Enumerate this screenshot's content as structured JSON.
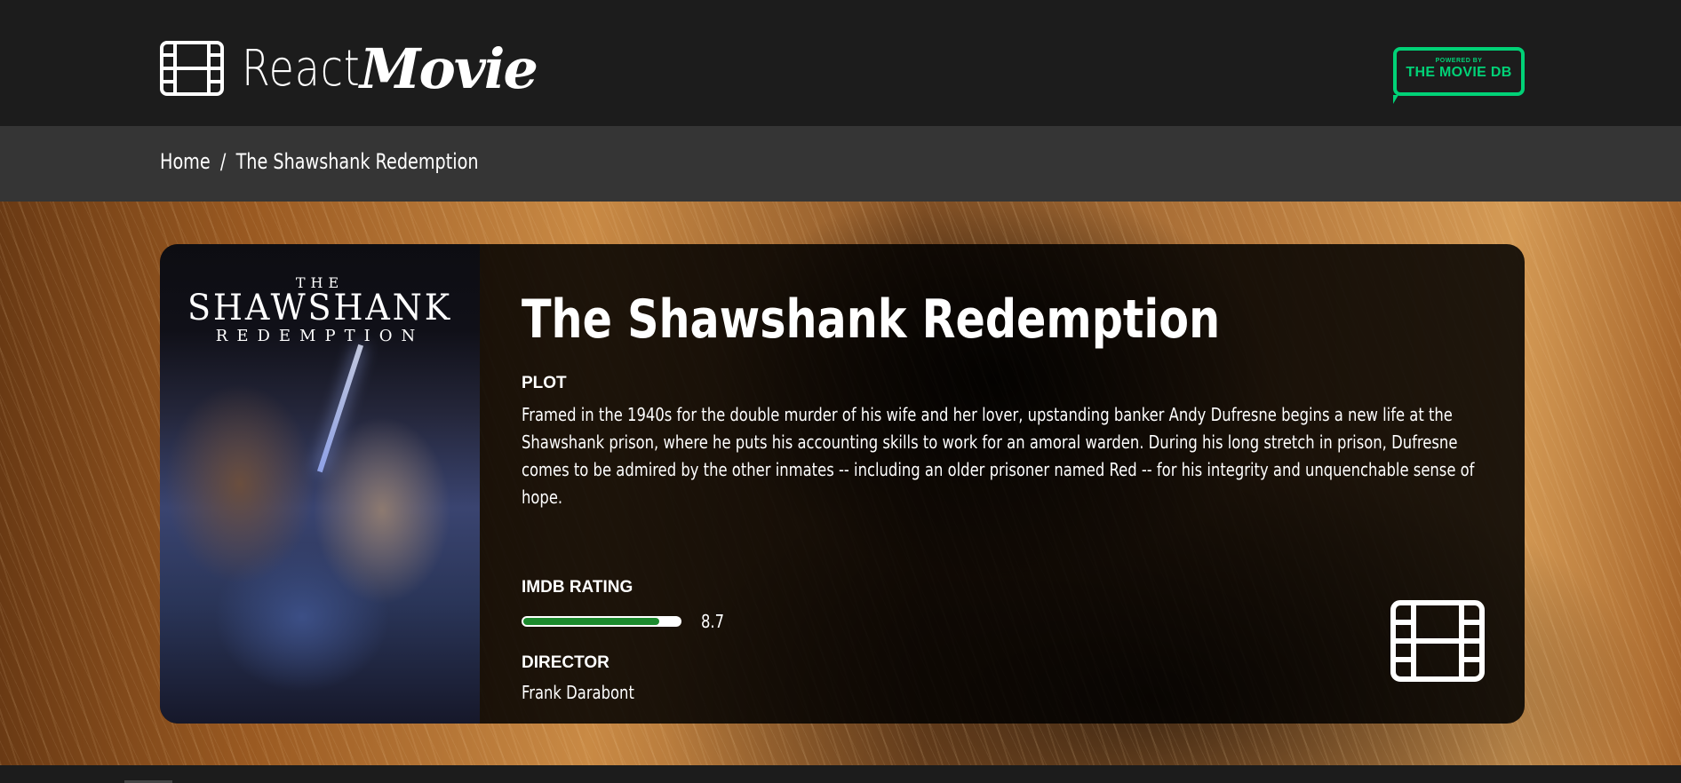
{
  "header": {
    "logo_text_1": "React",
    "logo_text_2": "Movie",
    "logo_icon": "film-icon",
    "tmdb_badge": {
      "powered_by": "POWERED BY",
      "name": "THE MOVIE DB",
      "color": "#01d277"
    }
  },
  "breadcrumb": {
    "home": "Home",
    "separator": "/",
    "current": "The Shawshank Redemption"
  },
  "movie": {
    "poster": {
      "the": "THE",
      "title": "SHAWSHANK",
      "subtitle": "REDEMPTION"
    },
    "title": "The Shawshank Redemption",
    "plot_label": "PLOT",
    "plot": "Framed in the 1940s for the double murder of his wife and her lover, upstanding banker Andy Dufresne begins a new life at the Shawshank prison, where he puts his accounting skills to work for an amoral warden. During his long stretch in prison, Dufresne comes to be admired by the other inmates -- including an older prisoner named Red -- for his integrity and unquenchable sense of hope.",
    "rating_label": "IMDB RATING",
    "rating": "8.7",
    "rating_fraction": 0.87,
    "rating_color": "#1c8a2e",
    "director_label": "DIRECTOR",
    "director": "Frank Darabont",
    "card_icon": "film-icon"
  }
}
